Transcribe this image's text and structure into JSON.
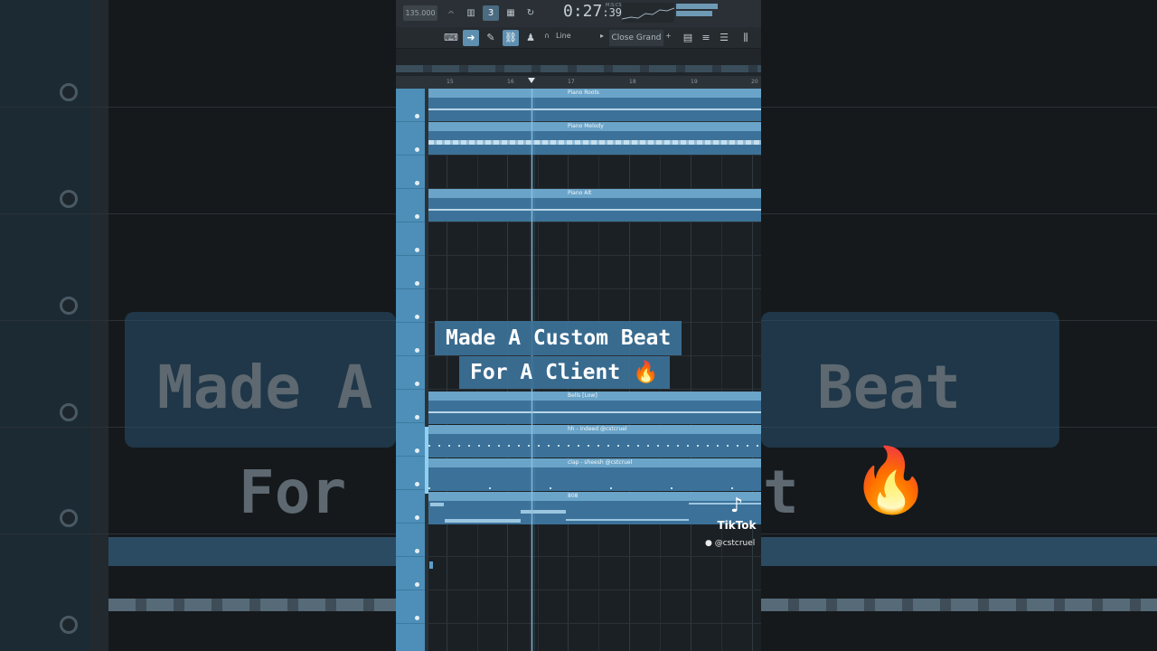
{
  "caption": {
    "line1": "Made A Custom Beat",
    "line2": "For A Client",
    "emoji": "🔥"
  },
  "background_text": {
    "line1": "Made A",
    "line1_end": "Beat",
    "line2": "For",
    "line2_end": "t"
  },
  "toolbar": {
    "tempo": "135.000",
    "time_main": "0:27",
    "time_frac": ":39",
    "time_format": "M:S:CS",
    "snap_label": "Line",
    "preset_label": "Close Grand"
  },
  "ruler": {
    "bars": [
      "15",
      "16",
      "17",
      "18",
      "19",
      "20"
    ]
  },
  "playlist": {
    "clips": [
      {
        "label": "Piano Roots",
        "kind": "audio"
      },
      {
        "label": "Piano Melody",
        "kind": "audio"
      },
      {
        "label": "Piano Alt",
        "kind": "audio"
      },
      {
        "label": "Bells [Low]",
        "kind": "audio"
      },
      {
        "label": "hh - indeed @cstcruel",
        "kind": "pattern"
      },
      {
        "label": "clap - sheesh @cstcruel",
        "kind": "pattern"
      },
      {
        "label": "808",
        "kind": "pattern"
      }
    ]
  },
  "watermark": {
    "brand": "TikTok",
    "user": "@cstcruel"
  },
  "colors": {
    "clip": "#3c7299",
    "clip_header": "#6aa4c9",
    "tracklist": "#4d8fb8"
  }
}
